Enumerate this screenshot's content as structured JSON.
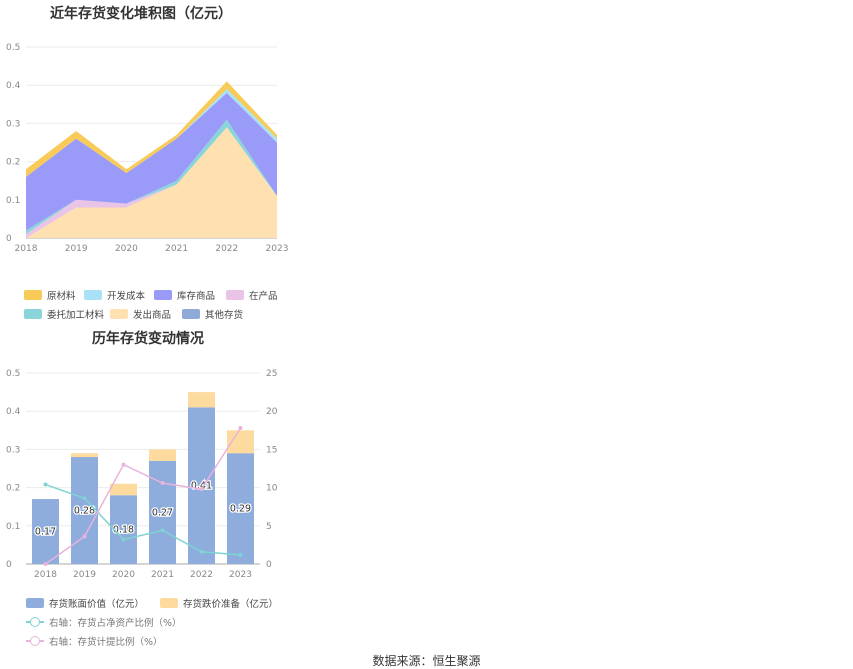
{
  "source_text": "数据来源：恒生聚源",
  "chart_data": [
    {
      "type": "area",
      "title": "近年存货变化堆积图（亿元）",
      "x": [
        "2018",
        "2019",
        "2020",
        "2021",
        "2022",
        "2023"
      ],
      "ylim": [
        0,
        0.5
      ],
      "yticks": [
        "0",
        "0.1",
        "0.2",
        "0.3",
        "0.4",
        "0.5"
      ],
      "stacked": true,
      "grid": true,
      "legend_position": "bottom",
      "series": [
        {
          "name": "发出商品",
          "color": "#ffe0b0",
          "values": [
            0.0,
            0.08,
            0.08,
            0.14,
            0.29,
            0.11
          ]
        },
        {
          "name": "在产品",
          "color": "#e9c4e6",
          "values": [
            0.01,
            0.02,
            0.01,
            0.0,
            0.0,
            0.0
          ]
        },
        {
          "name": "委托加工材料",
          "color": "#8ad5da",
          "values": [
            0.01,
            0.0,
            0.0,
            0.01,
            0.02,
            0.0
          ]
        },
        {
          "name": "库存商品",
          "color": "#9a9af8",
          "values": [
            0.14,
            0.16,
            0.08,
            0.11,
            0.07,
            0.14
          ]
        },
        {
          "name": "开发成本",
          "color": "#a9e1f6",
          "values": [
            0.0,
            0.0,
            0.0,
            0.0,
            0.01,
            0.01
          ]
        },
        {
          "name": "原材料",
          "color": "#f8ca58",
          "values": [
            0.02,
            0.02,
            0.01,
            0.01,
            0.02,
            0.01
          ]
        },
        {
          "name": "其他存货",
          "color": "#8fa9d8",
          "values": [
            0,
            0,
            0,
            0,
            0,
            0
          ]
        }
      ],
      "legend_order": [
        "原材料",
        "开发成本",
        "库存商品",
        "在产品",
        "委托加工材料",
        "发出商品",
        "其他存货"
      ]
    },
    {
      "type": "bar",
      "title": "历年存货变动情况",
      "categories": [
        "2018",
        "2019",
        "2020",
        "2021",
        "2022",
        "2023"
      ],
      "ylim": [
        0,
        0.5
      ],
      "yticks": [
        "0",
        "0.1",
        "0.2",
        "0.3",
        "0.4",
        "0.5"
      ],
      "y2lim": [
        0,
        25
      ],
      "y2ticks": [
        "0",
        "5",
        "10",
        "15",
        "20",
        "25"
      ],
      "grid": true,
      "legend_position": "bottom",
      "series": [
        {
          "name": "存货账面价值（亿元）",
          "kind": "bar",
          "color": "#8eacdc",
          "values": [
            0.17,
            0.28,
            0.18,
            0.27,
            0.41,
            0.29
          ],
          "labels": [
            "0.17",
            "0.28",
            "0.18",
            "0.27",
            "0.41",
            "0.29"
          ]
        },
        {
          "name": "存货跌价准备（亿元）",
          "kind": "bar",
          "color": "#fddb9f",
          "values": [
            0.0,
            0.01,
            0.03,
            0.03,
            0.04,
            0.06
          ]
        },
        {
          "name": "右轴：存货占净资产比例（%）",
          "kind": "line",
          "axis": "right",
          "color": "#7fd3d3",
          "values": [
            10.4,
            8.6,
            3.2,
            4.4,
            1.6,
            1.2
          ]
        },
        {
          "name": "右轴：存货计提比例（%）",
          "kind": "line",
          "axis": "right",
          "color": "#e8b3dc",
          "values": [
            0.0,
            3.6,
            13.0,
            10.6,
            9.8,
            17.8
          ]
        }
      ]
    }
  ]
}
